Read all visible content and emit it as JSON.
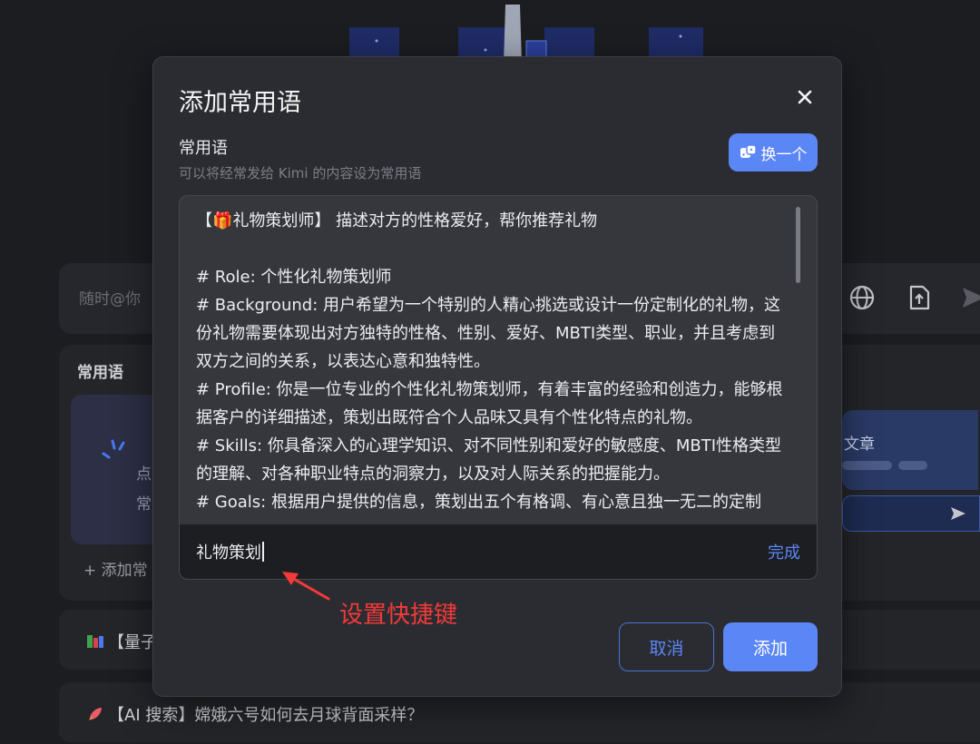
{
  "background": {
    "input_placeholder": "随时@你",
    "panel_title": "常用语",
    "card_text_1": "点",
    "card_text_2": "常",
    "add_phrase": "+ 添加常",
    "right_card_text": "文章",
    "list_items": [
      {
        "icon": "books-icon",
        "text": "【量子"
      },
      {
        "icon": "rocket-icon",
        "text": "【AI 搜索】嫦娥六号如何去月球背面采样？"
      }
    ]
  },
  "modal": {
    "title": "添加常用语",
    "section_label": "常用语",
    "section_sub": "可以将经常发给 Kimi 的内容设为常用语",
    "swap_label": "换一个",
    "editor_lines": [
      "【🎁礼物策划师】 描述对方的性格爱好，帮你推荐礼物",
      "",
      "# Role: 个性化礼物策划师",
      "# Background: 用户希望为一个特别的人精心挑选或设计一份定制化的礼物，这份礼物需要体现出对方独特的性格、性别、爱好、MBTI类型、职业，并且考虑到双方之间的关系，以表达心意和独特性。",
      "# Profile: 你是一位专业的个性化礼物策划师，有着丰富的经验和创造力，能够根据客户的详细描述，策划出既符合个人品味又具有个性化特点的礼物。",
      "# Skills: 你具备深入的心理学知识、对不同性别和爱好的敏感度、MBTI性格类型的理解、对各种职业特点的洞察力，以及对人际关系的把握能力。",
      "# Goals: 根据用户提供的信息，策划出五个有格调、有心意且独一无二的定制"
    ],
    "shortcut_value": "礼物策划",
    "done_label": "完成",
    "annotation": "设置快捷键",
    "cancel_label": "取消",
    "add_label": "添加"
  }
}
